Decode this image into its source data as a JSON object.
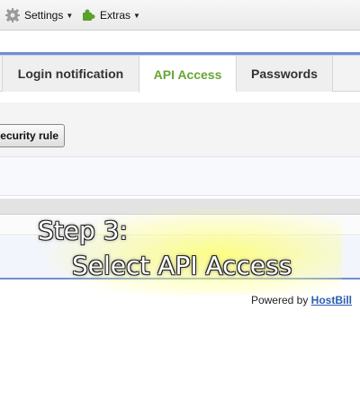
{
  "menu": {
    "settings_label": "Settings",
    "extras_label": "Extras",
    "settings_icon": "gear-icon",
    "extras_icon": "puzzle-icon"
  },
  "tabs": [
    {
      "label": "Login notification",
      "active": false
    },
    {
      "label": "API Access",
      "active": true
    },
    {
      "label": "Passwords",
      "active": false
    }
  ],
  "toolbar": {
    "security_rule_label": "security rule"
  },
  "overlay": {
    "line1": "Step 3:",
    "line2": "Select API Access"
  },
  "footer": {
    "prefix": "Powered by ",
    "link": "HostBill"
  },
  "colors": {
    "accent_blue": "#6f8fcf",
    "active_tab": "#66a533",
    "link": "#2a5db0"
  }
}
